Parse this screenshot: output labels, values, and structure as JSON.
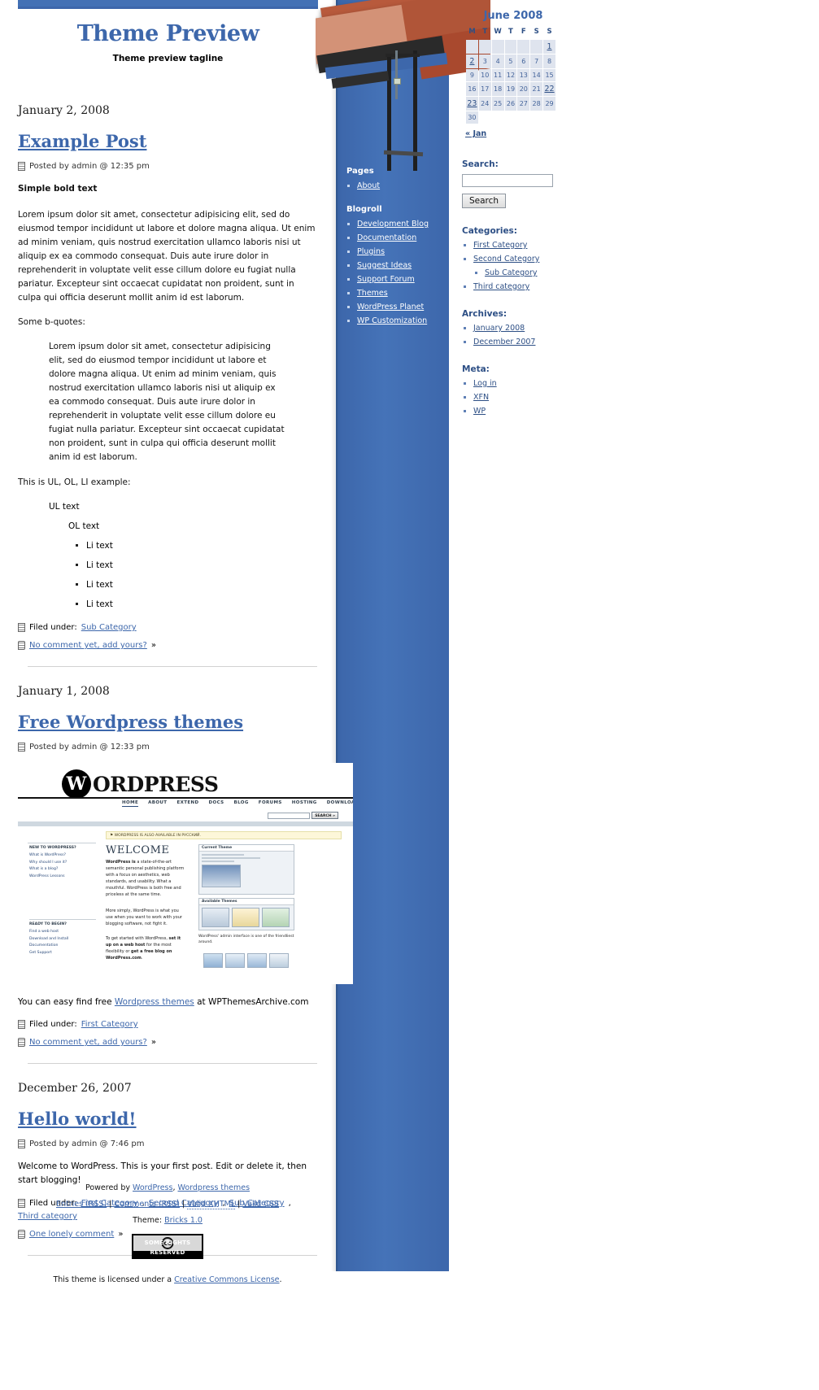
{
  "site": {
    "title": "Theme Preview",
    "tagline": "Theme preview tagline"
  },
  "posts": [
    {
      "date": "January 2, 2008",
      "title": "Example Post",
      "meta": "Posted by admin @ 12:35 pm",
      "bold_line": "Simple bold text",
      "paragraph": "Lorem ipsum dolor sit amet, consectetur adipisicing elit, sed do eiusmod tempor incididunt ut labore et dolore magna aliqua. Ut enim ad minim veniam, quis nostrud exercitation ullamco laboris nisi ut aliquip ex ea commodo consequat. Duis aute irure dolor in reprehenderit in voluptate velit esse cillum dolore eu fugiat nulla pariatur. Excepteur sint occaecat cupidatat non proident, sunt in culpa qui officia deserunt mollit anim id est laborum.",
      "blockquote_intro": "Some b-quotes:",
      "blockquote": "Lorem ipsum dolor sit amet, consectetur adipisicing elit, sed do eiusmod tempor incididunt ut labore et dolore magna aliqua. Ut enim ad minim veniam, quis nostrud exercitation ullamco laboris nisi ut aliquip ex ea commodo consequat. Duis aute irure dolor in reprehenderit in voluptate velit esse cillum dolore eu fugiat nulla pariatur. Excepteur sint occaecat cupidatat non proident, sunt in culpa qui officia deserunt mollit anim id est laborum.",
      "list_intro": "This is UL, OL, LI example:",
      "ul_text": "UL text",
      "ol_text": "OL text",
      "li_items": [
        "Li text",
        "Li text",
        "Li text",
        "Li text"
      ],
      "filed_label": "Filed under:",
      "categories": [
        "Sub Category"
      ],
      "comments_link": "No comment yet, add yours?",
      "comments_suffix": "»"
    },
    {
      "date": "January 1, 2008",
      "title": "Free Wordpress themes",
      "meta": "Posted by admin @ 12:33 pm",
      "body_prefix": "You can easy find free ",
      "body_link": "Wordpress themes",
      "body_suffix": " at WPThemesArchive.com",
      "filed_label": "Filed under:",
      "categories": [
        "First Category"
      ],
      "comments_link": "No comment yet, add yours?",
      "comments_suffix": "»"
    },
    {
      "date": "December 26, 2007",
      "title": "Hello world!",
      "meta": "Posted by admin @ 7:46 pm",
      "body": "Welcome to WordPress. This is your first post. Edit or delete it, then start blogging!",
      "filed_label": "Filed under:",
      "categories": [
        "First Category",
        "Second Category",
        "Sub Category",
        "Third category"
      ],
      "comments_link": "One lonely comment",
      "comments_suffix": "»"
    }
  ],
  "wp_screenshot": {
    "wordmark": "ORDPRESS",
    "logo_letter": "W",
    "nav": [
      "HOME",
      "ABOUT",
      "EXTEND",
      "DOCS",
      "BLOG",
      "FORUMS",
      "HOSTING",
      "DOWNLOAD"
    ],
    "search_button": "SEARCH »",
    "notice": "⚑ WORDPRESS IS ALSO AVAILABLE IN РУССКИЙ.",
    "welcome": "WELCOME",
    "lead_bold": "WordPress is",
    "lead_text": " a state-of-the-art semantic personal publishing platform with a focus on aesthetics, web standards, and usability. What a mouthful. WordPress is both free and priceless at the same time.",
    "para2": "More simply, WordPress is what you use when you want to work with your blogging software, not fight it.",
    "para3_prefix": "To get started with WordPress, ",
    "para3_link1": "set it up on a web host",
    "para3_mid": " for the most flexibility or ",
    "para3_link2": "get a free blog on WordPress.com",
    "para3_suffix": ".",
    "sidebar_head1": "NEW TO WORDPRESS?",
    "sidebar_links1": [
      "What is WordPress?",
      "Why should I use it?",
      "What is a blog?",
      "WordPress Lessons"
    ],
    "sidebar_head2": "READY TO BEGIN?",
    "sidebar_links2": [
      "Find a web host",
      "Download and Install",
      "Documentation",
      "Get Support"
    ],
    "panel_title": "Current Theme",
    "panel2_title": "Available Themes",
    "caption": "WordPress' admin interface is one of the friendliest around."
  },
  "mid_sidebar": {
    "pages_heading": "Pages",
    "pages": [
      "About"
    ],
    "blogroll_heading": "Blogroll",
    "blogroll": [
      "Development Blog",
      "Documentation",
      "Plugins",
      "Suggest Ideas",
      "Support Forum",
      "Themes",
      "WordPress Planet",
      "WP Customization"
    ]
  },
  "calendar": {
    "caption": "June 2008",
    "weekdays": [
      "M",
      "T",
      "W",
      "T",
      "F",
      "S",
      "S"
    ],
    "weeks": [
      [
        "",
        "",
        "",
        "",
        "",
        "",
        "1"
      ],
      [
        "2",
        "3",
        "4",
        "5",
        "6",
        "7",
        "8"
      ],
      [
        "9",
        "10",
        "11",
        "12",
        "13",
        "14",
        "15"
      ],
      [
        "16",
        "17",
        "18",
        "19",
        "20",
        "21",
        "22"
      ],
      [
        "23",
        "24",
        "25",
        "26",
        "27",
        "28",
        "29"
      ],
      [
        "30",
        "",
        "",
        "",
        "",
        "",
        ""
      ]
    ],
    "linked_days": [
      "1",
      "2",
      "22",
      "23"
    ],
    "prev_label": "« Jan"
  },
  "search": {
    "heading": "Search:",
    "value": "",
    "placeholder": "",
    "button": "Search"
  },
  "categories": {
    "heading": "Categories:",
    "items": [
      {
        "label": "First Category",
        "children": []
      },
      {
        "label": "Second Category",
        "children": [
          "Sub Category"
        ]
      },
      {
        "label": "Third category",
        "children": []
      }
    ]
  },
  "archives": {
    "heading": "Archives:",
    "items": [
      "January 2008",
      "December 2007"
    ]
  },
  "meta": {
    "heading": "Meta:",
    "items": [
      "Log in",
      "XFN",
      "WP"
    ]
  },
  "footer": {
    "powered_prefix": "Powered by ",
    "powered_link1": "WordPress",
    "powered_sep": ", ",
    "powered_link2": "Wordpress themes",
    "links": [
      "Entries (RSS)",
      "Comments (RSS)",
      "Valid XHTML",
      "Valid CSS"
    ],
    "separator": "|",
    "theme_prefix": "Theme: ",
    "theme_link": "Bricks 1.0",
    "cc_mark": "cc",
    "cc_text": "SOME RIGHTS RESERVED",
    "license_prefix": "This theme is licensed under a ",
    "license_link": "Creative Commons License",
    "license_suffix": "."
  },
  "colors": {
    "accent_blue": "#3d67ab",
    "sidebar_blue": "#3d67ab",
    "link_blue": "#2d4f85",
    "calendar_cell": "#dfe4ee"
  }
}
